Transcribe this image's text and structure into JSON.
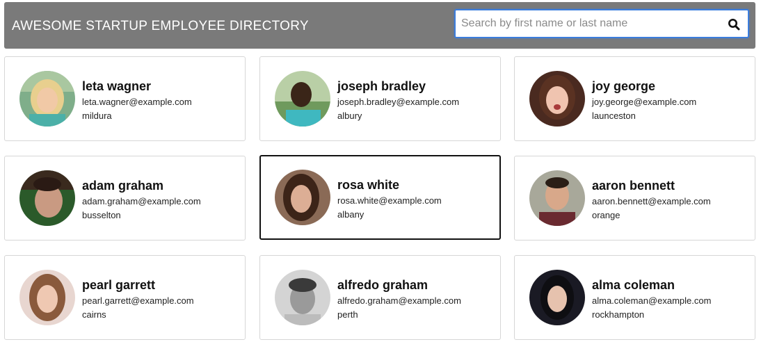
{
  "header": {
    "title": "AWESOME STARTUP EMPLOYEE DIRECTORY",
    "bg_color": "#7a7a7a"
  },
  "search": {
    "placeholder": "Search by first name or last name",
    "value": "",
    "icon": "search-icon",
    "accent_color": "#3b7ddd"
  },
  "employees": [
    {
      "name": "leta wagner",
      "email": "leta.wagner@example.com",
      "city": "mildura"
    },
    {
      "name": "joseph bradley",
      "email": "joseph.bradley@example.com",
      "city": "albury"
    },
    {
      "name": "joy george",
      "email": "joy.george@example.com",
      "city": "launceston"
    },
    {
      "name": "adam graham",
      "email": "adam.graham@example.com",
      "city": "busselton"
    },
    {
      "name": "rosa white",
      "email": "rosa.white@example.com",
      "city": "albany"
    },
    {
      "name": "aaron bennett",
      "email": "aaron.bennett@example.com",
      "city": "orange"
    },
    {
      "name": "pearl garrett",
      "email": "pearl.garrett@example.com",
      "city": "cairns"
    },
    {
      "name": "alfredo graham",
      "email": "alfredo.graham@example.com",
      "city": "perth"
    },
    {
      "name": "alma coleman",
      "email": "alma.coleman@example.com",
      "city": "rockhampton"
    }
  ],
  "selected_employee": "rosa white"
}
